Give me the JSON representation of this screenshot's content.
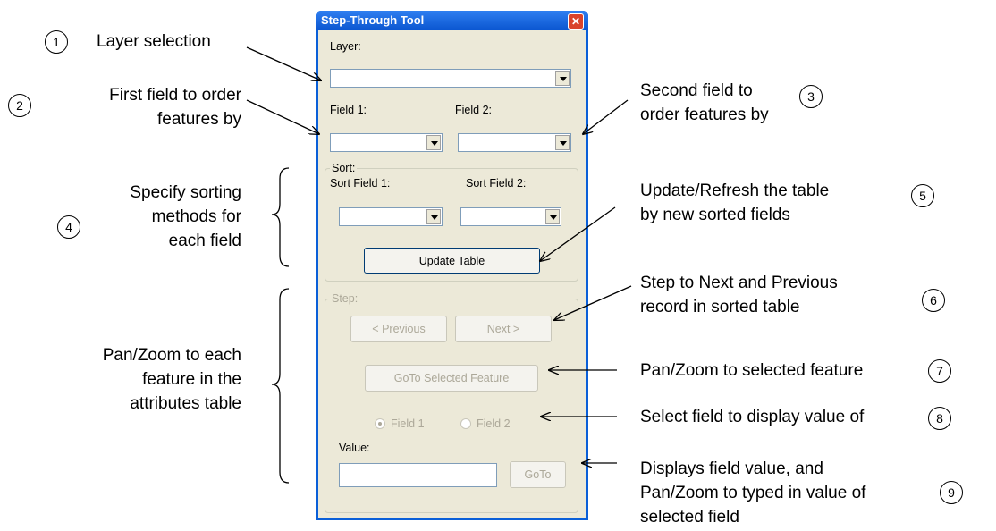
{
  "dialog": {
    "title": "Step-Through Tool",
    "close": "✕",
    "layer_label": "Layer:",
    "field1_label": "Field 1:",
    "field2_label": "Field 2:",
    "sort_group": "Sort:",
    "sort_field1_label": "Sort Field 1:",
    "sort_field2_label": "Sort Field 2:",
    "update_table": "Update Table",
    "step_group": "Step:",
    "previous": "< Previous",
    "next": "Next >",
    "goto_selected": "GoTo Selected Feature",
    "radio_field1": "Field 1",
    "radio_field2": "Field 2",
    "value_label": "Value:",
    "goto": "GoTo",
    "accent_color": "#0a5fd8"
  },
  "annotations": {
    "a1": {
      "num": "1",
      "text": "Layer selection"
    },
    "a2": {
      "num": "2",
      "line1": "First field to order",
      "line2": "features by"
    },
    "a3": {
      "num": "3",
      "line1": "Second field to",
      "line2": "order features by"
    },
    "a4": {
      "num": "4",
      "line1": "Specify sorting",
      "line2": "methods for",
      "line3": "each field"
    },
    "a5": {
      "num": "5",
      "line1": "Update/Refresh the table",
      "line2": "by new sorted fields"
    },
    "a6": {
      "num": "6",
      "line1": "Step to Next and Previous",
      "line2": "record in sorted table"
    },
    "a7": {
      "num": "7",
      "text": "Pan/Zoom to selected feature"
    },
    "a8": {
      "num": "8",
      "text": "Select field to display value of"
    },
    "a9": {
      "num": "9",
      "line1": "Displays field value, and",
      "line2": "Pan/Zoom to typed in value of",
      "line3": "selected field"
    },
    "pan": {
      "line1": "Pan/Zoom to each",
      "line2": "feature in the",
      "line3": "attributes table"
    }
  }
}
